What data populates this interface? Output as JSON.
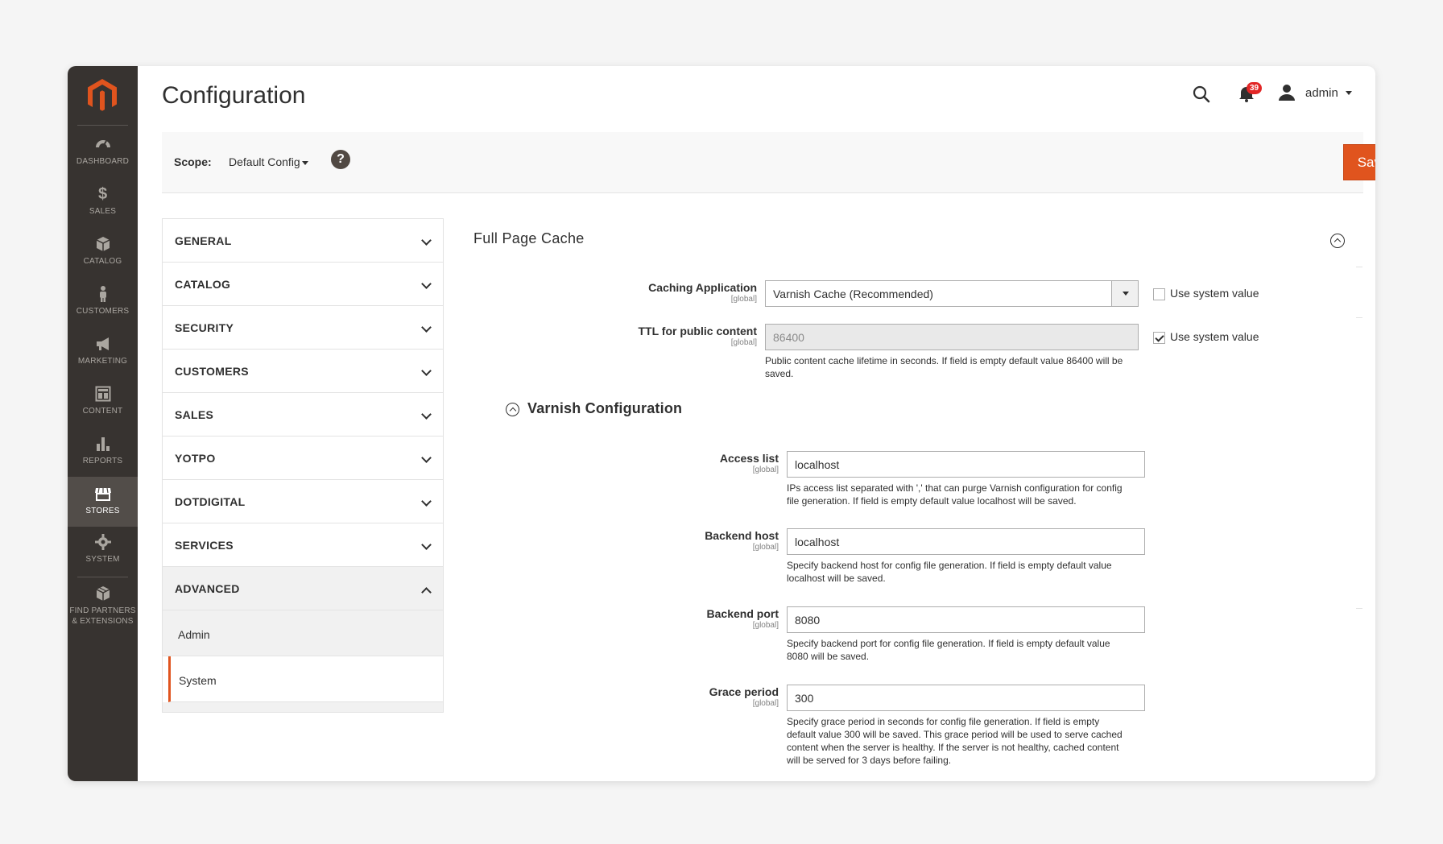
{
  "colors": {
    "accent": "#e0541e",
    "sidebar_bg": "#373330",
    "badge": "#e22626"
  },
  "sidebar": {
    "items": [
      {
        "label": "DASHBOARD",
        "icon": "dashboard-icon"
      },
      {
        "label": "SALES",
        "icon": "dollar-icon"
      },
      {
        "label": "CATALOG",
        "icon": "box-icon"
      },
      {
        "label": "CUSTOMERS",
        "icon": "person-icon"
      },
      {
        "label": "MARKETING",
        "icon": "megaphone-icon"
      },
      {
        "label": "CONTENT",
        "icon": "layout-icon"
      },
      {
        "label": "REPORTS",
        "icon": "bar-chart-icon"
      },
      {
        "label": "STORES",
        "icon": "store-icon"
      },
      {
        "label": "SYSTEM",
        "icon": "gear-icon"
      },
      {
        "label_line1": "FIND PARTNERS",
        "label_line2": "& EXTENSIONS",
        "icon": "cube-icon"
      }
    ]
  },
  "header": {
    "title": "Configuration",
    "notifications_count": "39",
    "user": "admin"
  },
  "scope": {
    "label": "Scope:",
    "value": "Default Config",
    "help": "?",
    "save_label": "Save Config"
  },
  "tabs": [
    {
      "label": "GENERAL"
    },
    {
      "label": "CATALOG"
    },
    {
      "label": "SECURITY"
    },
    {
      "label": "CUSTOMERS"
    },
    {
      "label": "SALES"
    },
    {
      "label": "YOTPO"
    },
    {
      "label": "DOTDIGITAL"
    },
    {
      "label": "SERVICES"
    },
    {
      "label": "ADVANCED",
      "open": true
    }
  ],
  "subtabs": [
    {
      "label": "Admin"
    },
    {
      "label": "System",
      "active": true
    }
  ],
  "section": {
    "title": "Full Page Cache",
    "caching_application": {
      "label": "Caching Application",
      "scope": "[global]",
      "value": "Varnish Cache (Recommended)",
      "use_system_label": "Use system value",
      "use_system_checked": false
    },
    "ttl": {
      "label": "TTL for public content",
      "scope": "[global]",
      "value": "86400",
      "note_line1": "Public content cache lifetime in seconds. If field is empty default value 86400 will be",
      "note_line2": "saved.",
      "use_system_label": "Use system value",
      "use_system_checked": true
    },
    "varnish": {
      "title": "Varnish Configuration",
      "access_list": {
        "label": "Access list",
        "scope": "[global]",
        "value": "localhost",
        "note_line1": "IPs access list separated with ',' that can purge Varnish configuration for config",
        "note_line2": "file generation. If field is empty default value localhost will be saved."
      },
      "backend_host": {
        "label": "Backend host",
        "scope": "[global]",
        "value": "localhost",
        "note_line1": "Specify backend host for config file generation. If field is empty default value",
        "note_line2": "localhost will be saved."
      },
      "backend_port": {
        "label": "Backend port",
        "scope": "[global]",
        "value": "8080",
        "note_line1": "Specify backend port for config file generation. If field is empty default value",
        "note_line2": "8080 will be saved."
      },
      "grace_period": {
        "label": "Grace period",
        "scope": "[global]",
        "value": "300",
        "note_line1": "Specify grace period in seconds for config file generation. If field is empty",
        "note_line2": "default value 300 will be saved. This grace period will be used to serve cached",
        "note_line3": "content when the server is healthy. If the server is not healthy, cached content",
        "note_line4": "will be served for 3 days before failing."
      }
    }
  }
}
